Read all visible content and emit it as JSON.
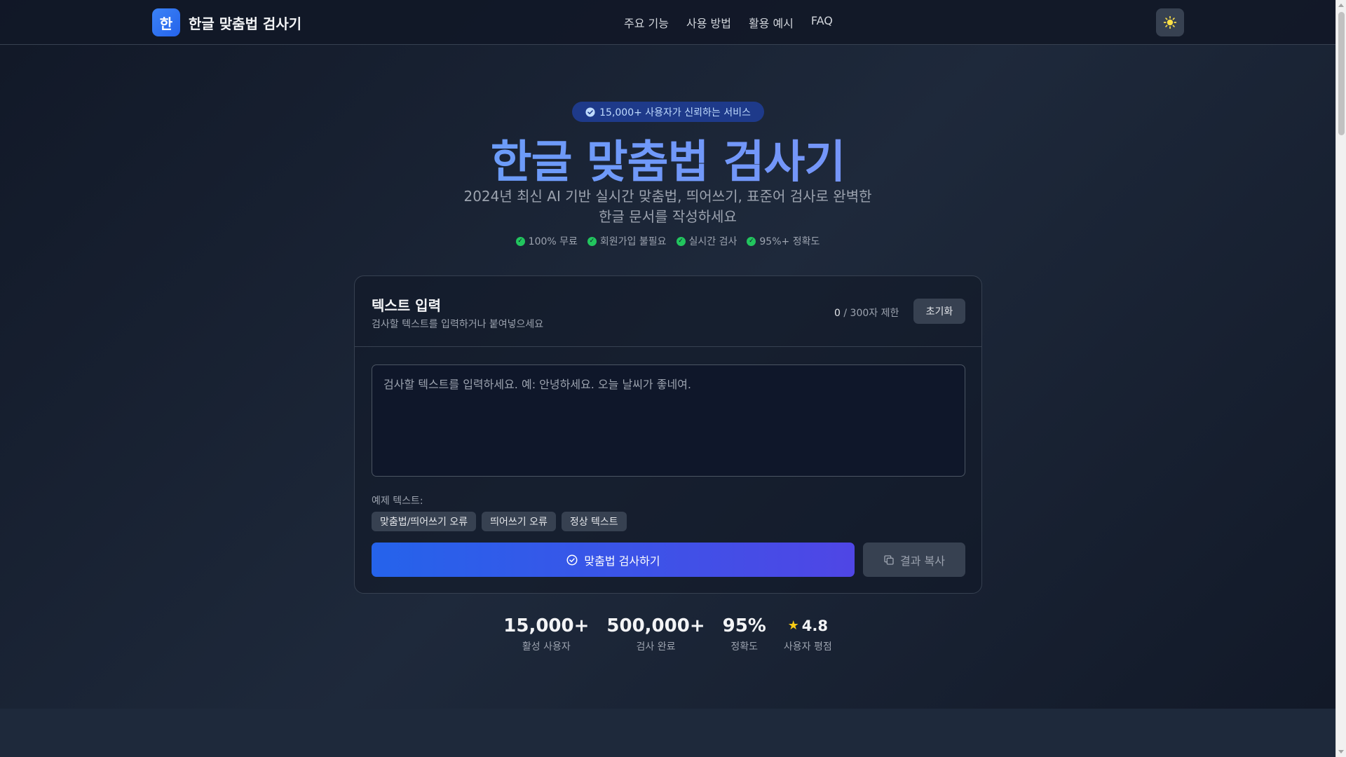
{
  "header": {
    "logo_char": "한",
    "brand": "한글 맞춤법 검사기",
    "nav": [
      "주요 기능",
      "사용 방법",
      "활용 예시",
      "FAQ"
    ]
  },
  "hero": {
    "badge": "15,000+ 사용자가 신뢰하는 서비스",
    "title": "한글 맞춤법 검사기",
    "subtitle": "2024년 최신 AI 기반 실시간 맞춤법, 띄어쓰기, 표준어 검사로 완벽한 한글 문서를 작성하세요",
    "features": [
      "100% 무료",
      "회원가입 불필요",
      "실시간 검사",
      "95%+ 정확도"
    ]
  },
  "card": {
    "title": "텍스트 입력",
    "description": "검사할 텍스트를 입력하거나 붙여넣으세요",
    "char_count": "0",
    "char_limit": "/ 300자 제한",
    "reset_label": "초기화",
    "textarea_value": "",
    "textarea_placeholder": "검사할 텍스트를 입력하세요. 예: 안녕하세요. 오늘 날씨가 좋네여.",
    "examples_label": "예제 텍스트:",
    "examples": [
      "맞춤법/띄어쓰기 오류",
      "띄어쓰기 오류",
      "정상 텍스트"
    ],
    "check_label": "맞춤법 검사하기",
    "copy_label": "결과 복사"
  },
  "stats": [
    {
      "value": "15,000+",
      "label": "활성 사용자"
    },
    {
      "value": "500,000+",
      "label": "검사 완료"
    },
    {
      "value": "95%",
      "label": "정확도"
    },
    {
      "value": "4.8",
      "label": "사용자 평점"
    }
  ],
  "colors": {
    "accent": "#2563eb",
    "accent_end": "#4f46e5",
    "check": "#22c55e",
    "star": "#facc15"
  },
  "icons": {
    "theme": "sun-icon",
    "badge": "check-circle-icon",
    "check_button": "check-circle-icon",
    "copy_button": "copy-icon",
    "rating": "star-icon"
  }
}
